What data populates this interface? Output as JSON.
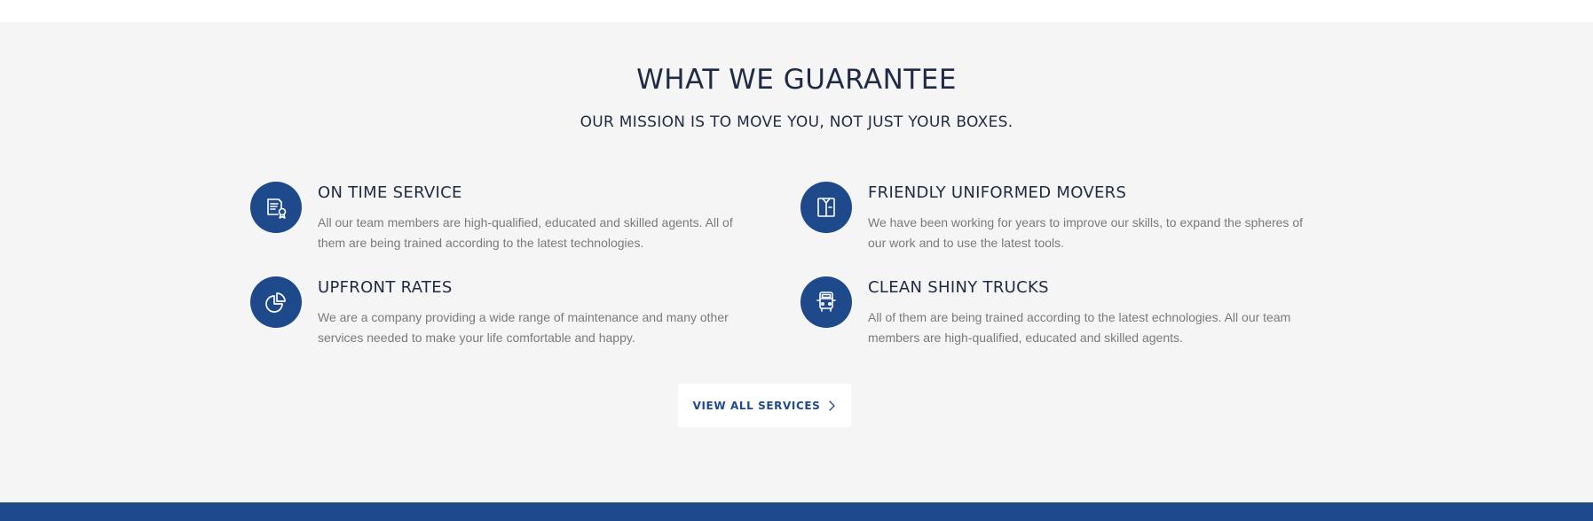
{
  "section": {
    "title": "WHAT WE GUARANTEE",
    "subtitle": "OUR MISSION IS TO MOVE YOU, NOT JUST YOUR BOXES."
  },
  "features": [
    {
      "icon": "certificate-icon",
      "title": "ON TIME SERVICE",
      "description": "All our team members are high-qualified, educated and skilled agents. All of them are being trained according to the latest technologies."
    },
    {
      "icon": "uniform-shirt-icon",
      "title": "FRIENDLY UNIFORMED MOVERS",
      "description": "We have been working for years to improve our skills, to expand the spheres of our work and to use the latest tools."
    },
    {
      "icon": "pie-chart-icon",
      "title": "UPFRONT RATES",
      "description": "We are a company providing a wide range of maintenance and many other services needed to make your life comfortable and happy."
    },
    {
      "icon": "truck-icon",
      "title": "CLEAN SHINY TRUCKS",
      "description": "All of them are being trained according to the latest echnologies. All our team members are high-qualified, educated and skilled agents."
    }
  ],
  "cta": {
    "label": "VIEW ALL SERVICES"
  },
  "colors": {
    "accent": "#1e4a8c",
    "heading": "#1f2a44",
    "body_text": "#7a7a7a",
    "section_bg": "#f5f5f5"
  }
}
